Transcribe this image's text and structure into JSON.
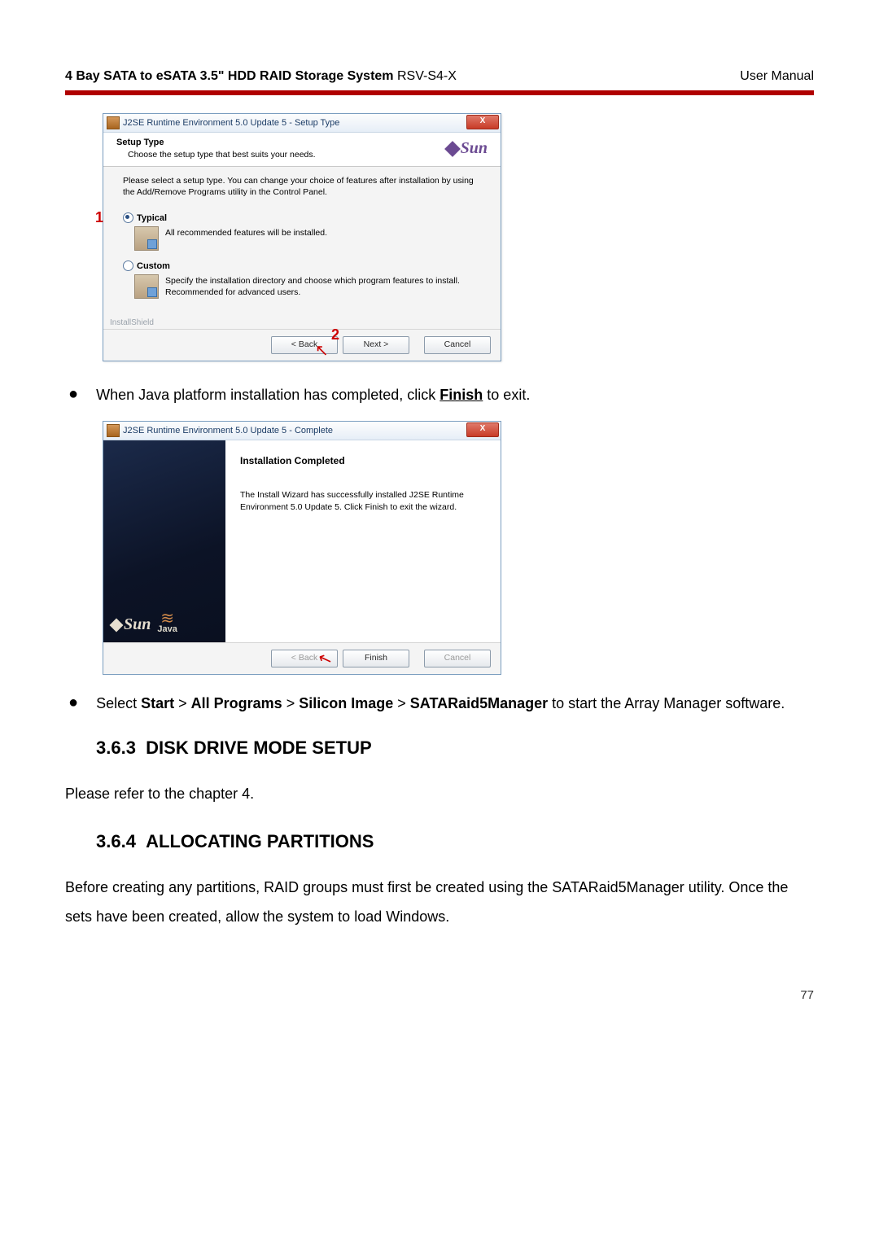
{
  "header": {
    "title_bold": "4 Bay SATA to eSATA 3.5\" HDD RAID Storage System",
    "title_model": " RSV-S4-X",
    "right": "User Manual"
  },
  "dialog1": {
    "title": "J2SE Runtime Environment 5.0 Update 5 - Setup Type",
    "close": "X",
    "header_bold": "Setup Type",
    "header_sub": "Choose the setup type that best suits your needs.",
    "sun": "Sun",
    "instruction": "Please select a setup type. You can change your choice of features after installation by using the Add/Remove Programs utility in the Control Panel.",
    "opt_typical": "Typical",
    "opt_typical_desc": "All recommended features will be installed.",
    "opt_custom": "Custom",
    "opt_custom_desc": "Specify the installation directory and choose which program features to install. Recommended for advanced users.",
    "installshield": "InstallShield",
    "back": "< Back",
    "next": "Next >",
    "cancel": "Cancel",
    "marker1": "1",
    "marker2": "2"
  },
  "bullet1_pre": "When Java platform installation has completed, click ",
  "bullet1_link": "Finish",
  "bullet1_post": " to exit.",
  "dialog2": {
    "title": "J2SE Runtime Environment 5.0 Update 5 - Complete",
    "close": "X",
    "sun": "Sun",
    "java": "Java",
    "heading": "Installation Completed",
    "text": "The Install Wizard has successfully installed J2SE Runtime Environment 5.0 Update 5. Click Finish to exit the wizard.",
    "back": "< Back",
    "finish": "Finish",
    "cancel": "Cancel"
  },
  "bullet2": {
    "pre": "Select ",
    "b1": "Start",
    "s1": " > ",
    "b2": "All Programs",
    "s2": " > ",
    "b3": "Silicon Image",
    "s3": " > ",
    "b4": "SATARaid5Manager",
    "post": " to start the Array Manager software."
  },
  "section363": {
    "num": "3.6.3",
    "title": "DISK DRIVE MODE SETUP",
    "para": "Please refer to the chapter 4."
  },
  "section364": {
    "num": "3.6.4",
    "title": "ALLOCATING PARTITIONS",
    "para": "Before creating any partitions, RAID groups must first be created using the SATARaid5Manager utility. Once the sets have been created, allow the system to load Windows."
  },
  "page_number": "77"
}
